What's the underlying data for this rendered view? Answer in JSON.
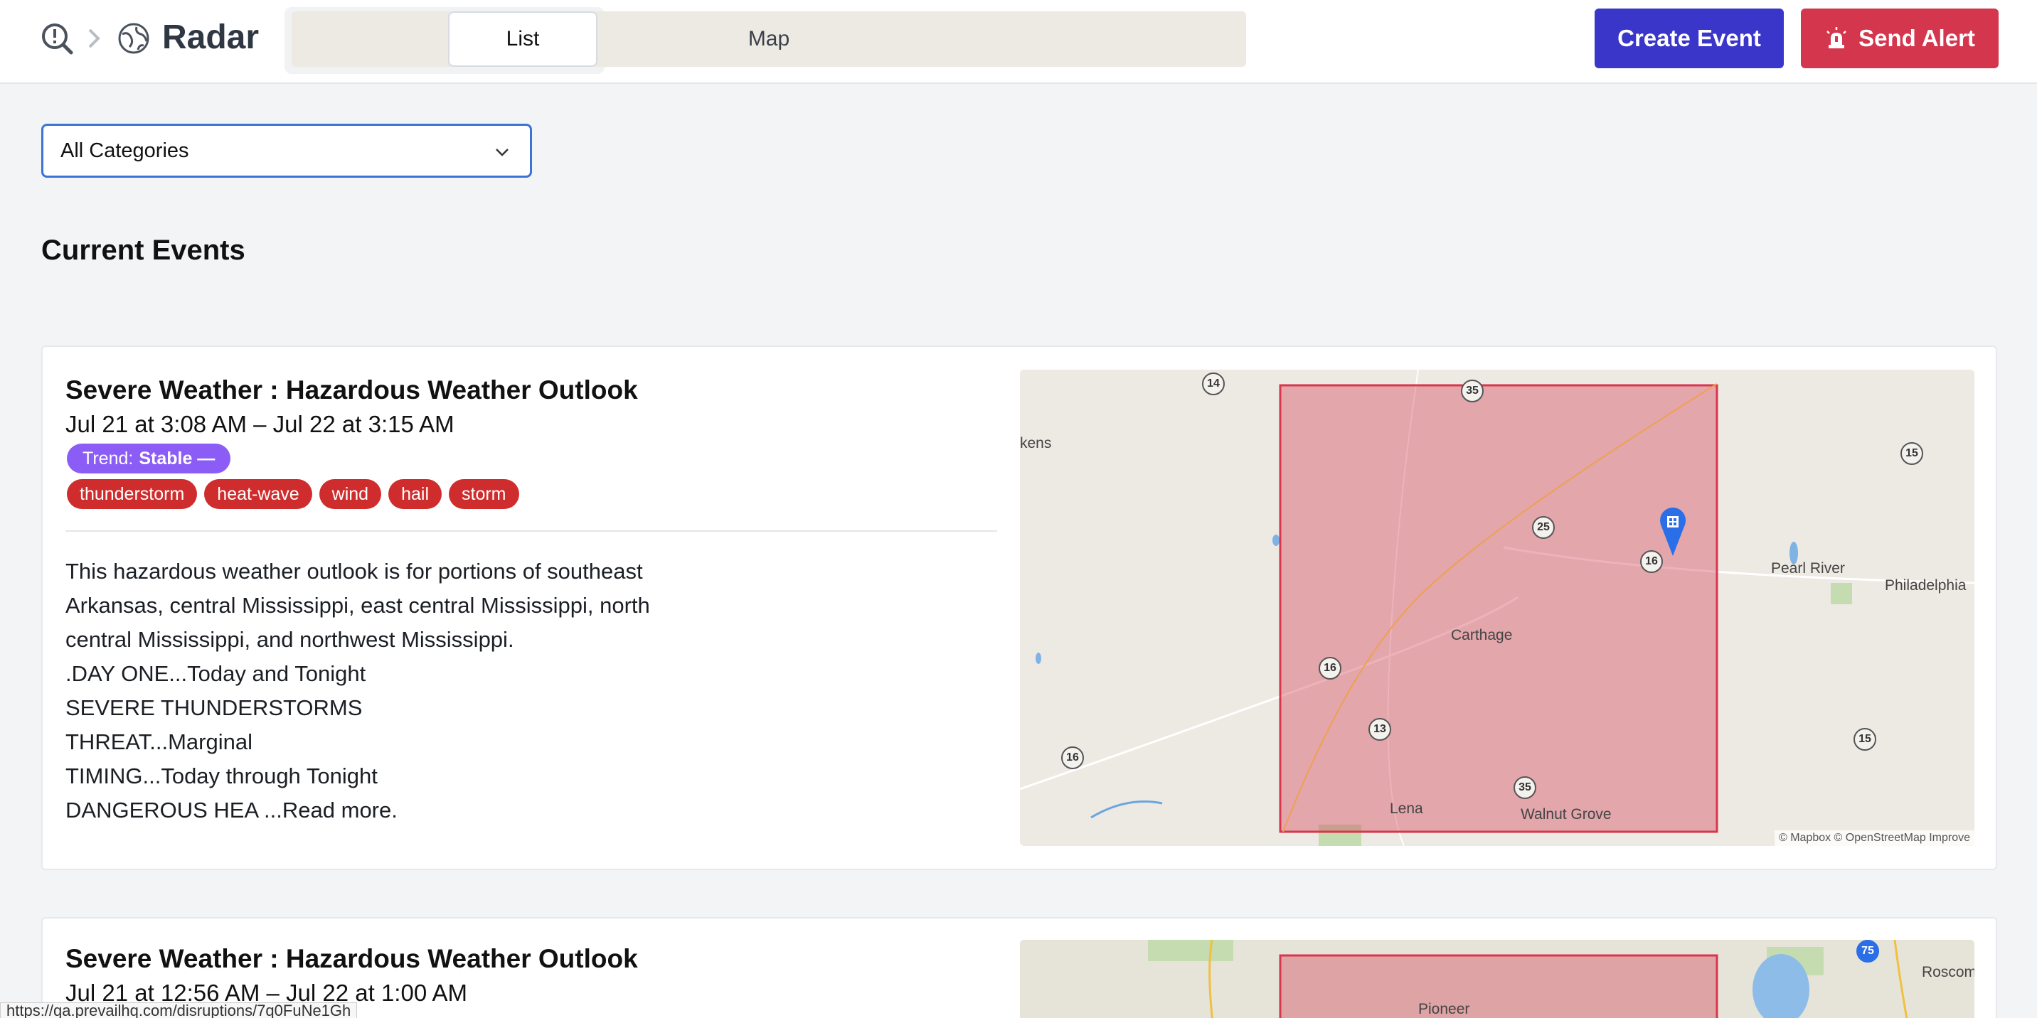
{
  "header": {
    "brand": "Radar",
    "view_toggle": [
      {
        "label": "Map"
      },
      {
        "label": "List"
      }
    ],
    "selected_view": "List",
    "create_button": "Create Event",
    "alert_button": "Send Alert",
    "colors": {
      "create": "#3a36c9",
      "alert": "#d4364e"
    }
  },
  "filters": {
    "category_select": "All Categories"
  },
  "section_title": "Current Events",
  "events": [
    {
      "title": "Severe Weather : Hazardous Weather Outlook",
      "time": "Jul 21 at 3:08 AM – Jul 22 at 3:15 AM",
      "trend_label": "Trend:",
      "trend_value": "Stable —",
      "tags": [
        "thunderstorm",
        "heat-wave",
        "wind",
        "hail",
        "storm"
      ],
      "description_lines": [
        "This hazardous weather outlook is for portions of southeast",
        "Arkansas, central Mississippi, east central Mississippi, north",
        "central Mississippi, and northwest Mississippi.",
        ".DAY ONE...Today and Tonight",
        "SEVERE THUNDERSTORMS",
        "THREAT...Marginal",
        "TIMING...Today through Tonight",
        "DANGEROUS HEA ...Read more."
      ],
      "map": {
        "places": [
          "kens",
          "Pearl River",
          "Philadelphia",
          "Carthage",
          "Lena",
          "Walnut Grove"
        ],
        "route_shields": [
          "14",
          "35",
          "15",
          "25",
          "16",
          "16",
          "13",
          "16",
          "35",
          "15"
        ],
        "attribution": "© Mapbox © OpenStreetMap",
        "improve": "Improve"
      }
    },
    {
      "title": "Severe Weather : Hazardous Weather Outlook",
      "time": "Jul 21 at 12:56 AM – Jul 22 at 1:00 AM",
      "map": {
        "places": [
          "Pioneer",
          "Roscomn"
        ],
        "route_shields": [
          "75"
        ]
      }
    }
  ],
  "status_bar": "https://qa.prevailhq.com/disruptions/7q0FuNe1Gh"
}
